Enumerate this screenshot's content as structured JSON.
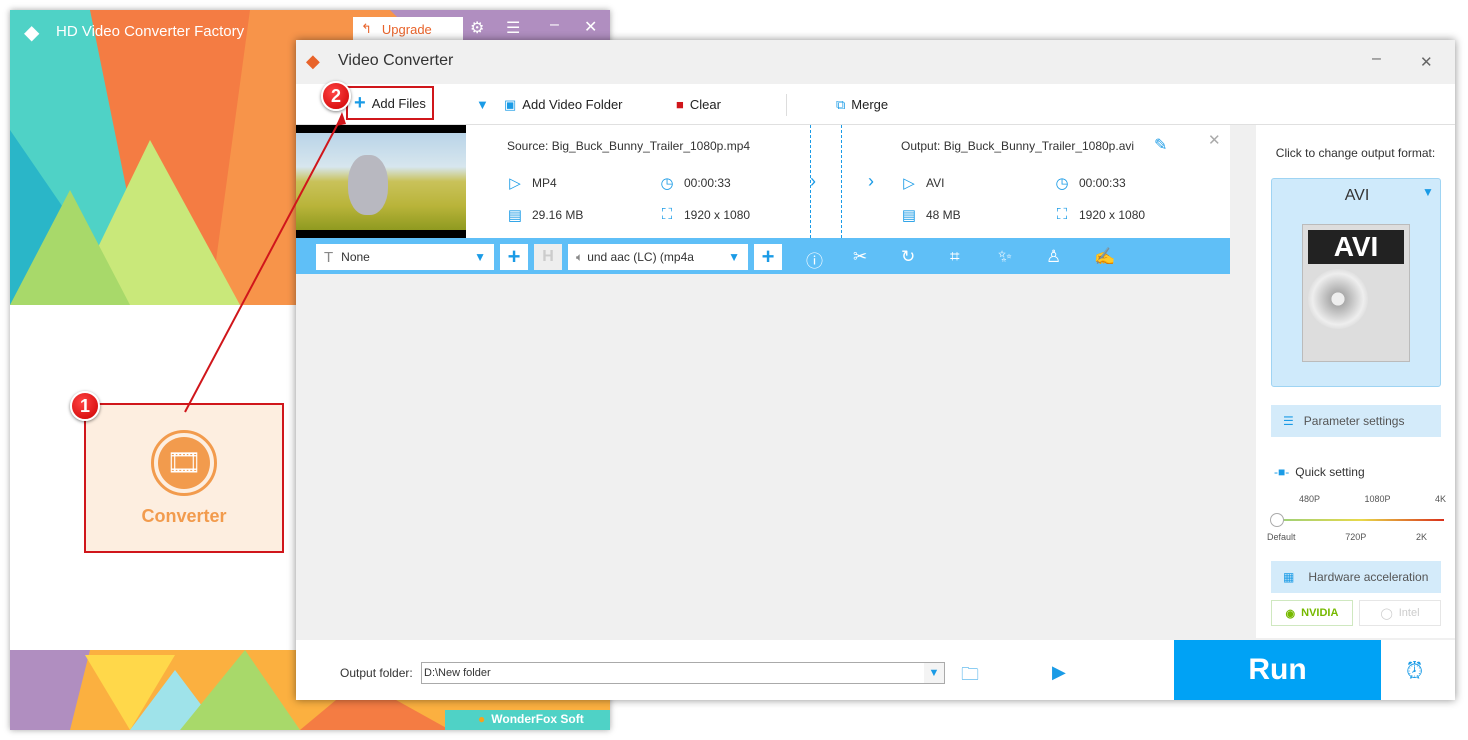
{
  "main_window": {
    "title": "HD Video Converter Factory",
    "upgrade_label": "Upgrade",
    "converter_label": "Converter",
    "brand": "WonderFox Soft"
  },
  "converter": {
    "title": "Video Converter",
    "toolbar": {
      "add_files": "Add Files",
      "add_video_folder": "Add Video Folder",
      "clear": "Clear",
      "merge": "Merge"
    },
    "file": {
      "source": "Source: Big_Buck_Bunny_Trailer_1080p.mp4",
      "src_format": "MP4",
      "src_duration": "00:00:33",
      "src_size": "29.16 MB",
      "src_resolution": "1920 x 1080",
      "output": "Output: Big_Buck_Bunny_Trailer_1080p.avi",
      "out_format": "AVI",
      "out_duration": "00:00:33",
      "out_size": "48 MB",
      "out_resolution": "1920 x 1080",
      "subtitle": "None",
      "audio": "und aac (LC) (mp4a"
    },
    "panel": {
      "hint": "Click to change output format:",
      "format": "AVI",
      "param_settings": "Parameter settings",
      "quick_setting": "Quick setting",
      "ticks_top": [
        "480P",
        "1080P",
        "4K"
      ],
      "ticks_bottom": [
        "Default",
        "720P",
        "2K"
      ],
      "quality_level": 0,
      "hw_accel": "Hardware acceleration",
      "nvidia": "NVIDIA",
      "intel": "Intel"
    },
    "bottom": {
      "output_folder_label": "Output folder:",
      "output_folder_value": "D:\\New folder",
      "run": "Run"
    }
  },
  "annotations": {
    "step1": "1",
    "step2": "2"
  },
  "colors": {
    "accent": "#1a9be6",
    "run": "#00a2f5",
    "annotation": "#d0161b",
    "teal": "#4fd2c6"
  }
}
